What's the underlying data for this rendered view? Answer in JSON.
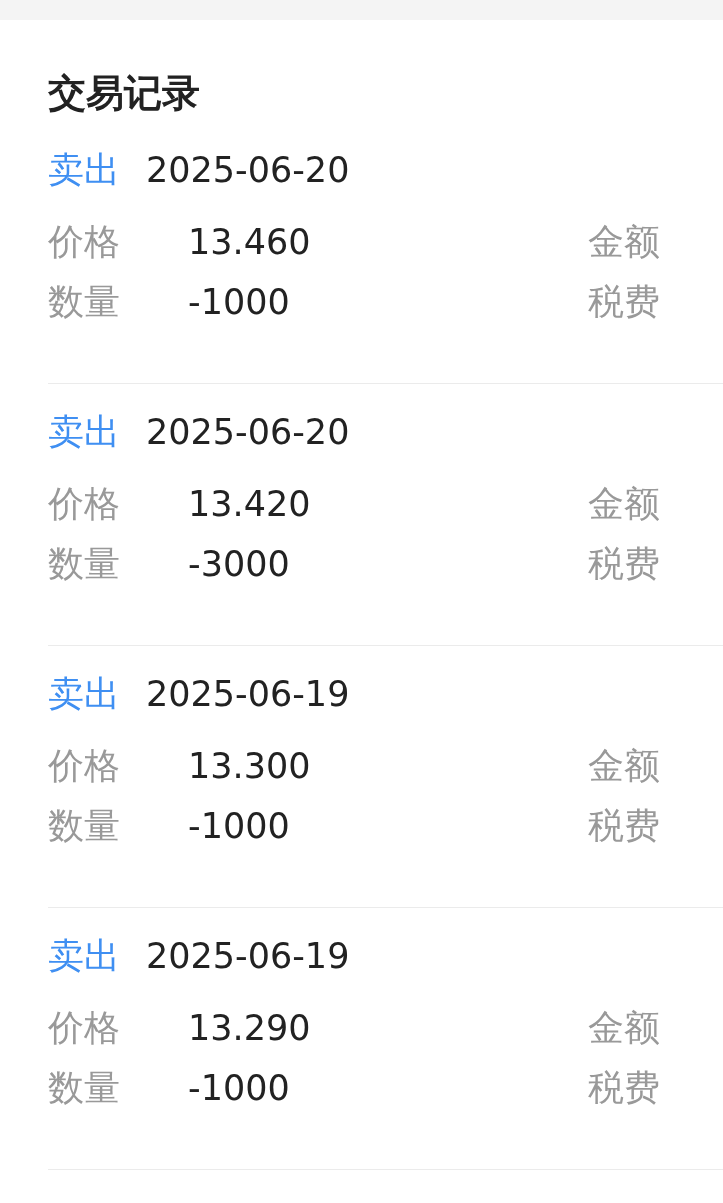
{
  "title": "交易记录",
  "records": [
    {
      "kind": "sell",
      "type": "卖出",
      "date": "2025-06-20",
      "price_label": "价格",
      "price": "13.460",
      "amount_label": "金额",
      "qty_label": "数量",
      "qty": "-1000",
      "fee_label": "税费"
    },
    {
      "kind": "sell",
      "type": "卖出",
      "date": "2025-06-20",
      "price_label": "价格",
      "price": "13.420",
      "amount_label": "金额",
      "qty_label": "数量",
      "qty": "-3000",
      "fee_label": "税费"
    },
    {
      "kind": "sell",
      "type": "卖出",
      "date": "2025-06-19",
      "price_label": "价格",
      "price": "13.300",
      "amount_label": "金额",
      "qty_label": "数量",
      "qty": "-1000",
      "fee_label": "税费"
    },
    {
      "kind": "sell",
      "type": "卖出",
      "date": "2025-06-19",
      "price_label": "价格",
      "price": "13.290",
      "amount_label": "金额",
      "qty_label": "数量",
      "qty": "-1000",
      "fee_label": "税费"
    }
  ]
}
